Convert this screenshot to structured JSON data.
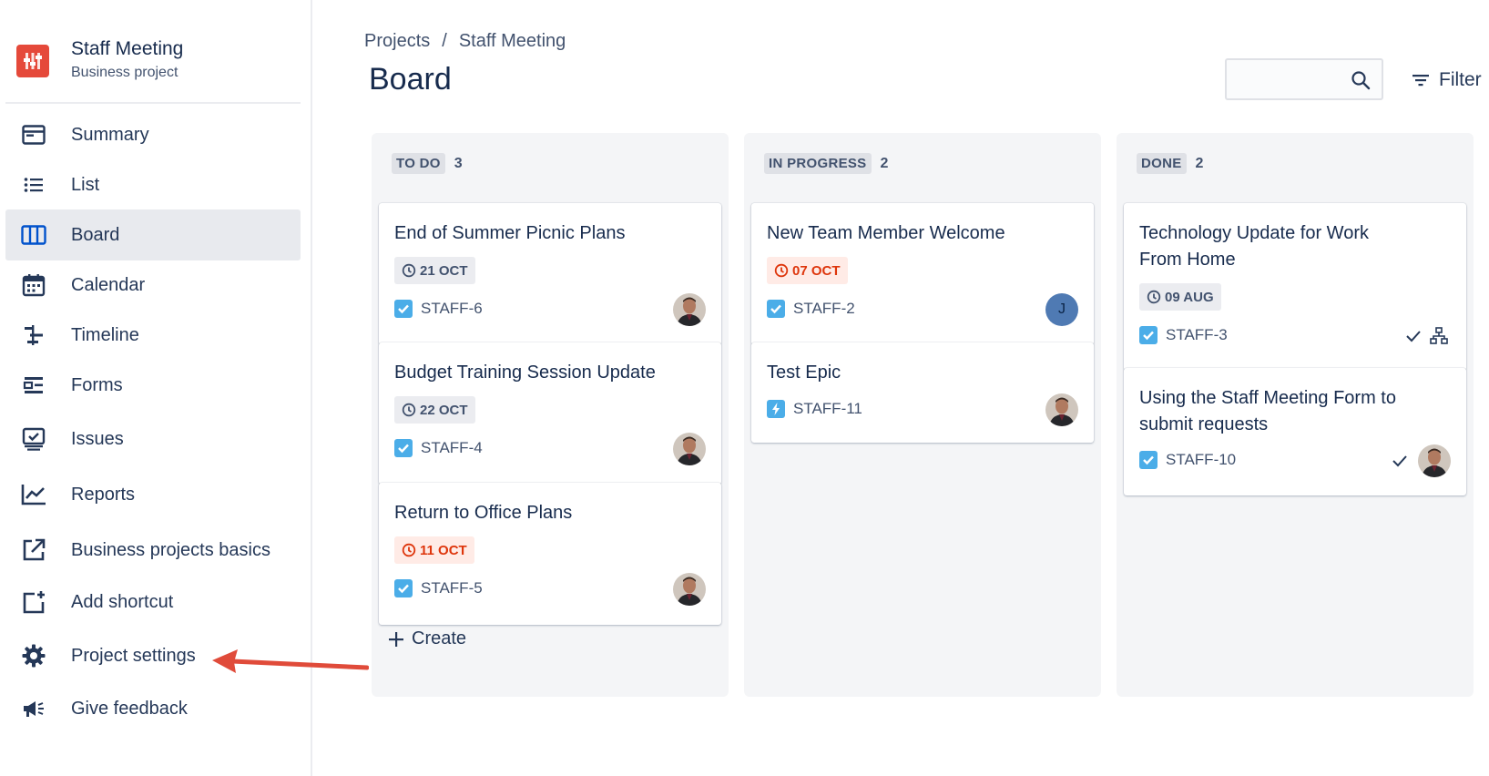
{
  "project": {
    "name": "Staff Meeting",
    "type": "Business project"
  },
  "sidebar": {
    "items": [
      {
        "label": "Summary",
        "icon": "summary-icon"
      },
      {
        "label": "List",
        "icon": "list-icon"
      },
      {
        "label": "Board",
        "icon": "board-icon",
        "active": true
      },
      {
        "label": "Calendar",
        "icon": "calendar-icon"
      },
      {
        "label": "Timeline",
        "icon": "timeline-icon"
      },
      {
        "label": "Forms",
        "icon": "forms-icon"
      },
      {
        "label": "Issues",
        "icon": "issues-icon"
      },
      {
        "label": "Reports",
        "icon": "reports-icon"
      },
      {
        "label": "Business projects basics",
        "icon": "external-link-icon"
      },
      {
        "label": "Add shortcut",
        "icon": "add-shortcut-icon"
      },
      {
        "label": "Project settings",
        "icon": "gear-icon"
      },
      {
        "label": "Give feedback",
        "icon": "megaphone-icon"
      }
    ]
  },
  "breadcrumb": {
    "root": "Projects",
    "separator": "/",
    "current": "Staff Meeting"
  },
  "page": {
    "title": "Board"
  },
  "search": {
    "value": "",
    "placeholder": ""
  },
  "filter": {
    "label": "Filter"
  },
  "columns": [
    {
      "title": "TO DO",
      "count": "3",
      "cards": [
        {
          "title": "End of Summer Picnic Plans",
          "due": "21 OCT",
          "overdue": false,
          "key": "STAFF-6",
          "type": "task"
        },
        {
          "title": "Budget Training Session Update",
          "due": "22 OCT",
          "overdue": false,
          "key": "STAFF-4",
          "type": "task"
        },
        {
          "title": "Return to Office Plans",
          "due": "11 OCT",
          "overdue": true,
          "key": "STAFF-5",
          "type": "task"
        }
      ],
      "create_label": "Create"
    },
    {
      "title": "IN PROGRESS",
      "count": "2",
      "cards": [
        {
          "title": "New Team Member Welcome",
          "due": "07 OCT",
          "overdue": true,
          "key": "STAFF-2",
          "type": "task",
          "avatar_initial": "J"
        },
        {
          "title": "Test Epic",
          "key": "STAFF-11",
          "type": "epic"
        }
      ]
    },
    {
      "title": "DONE",
      "count": "2",
      "cards": [
        {
          "title_line1": "Technology Update for Work",
          "title_line2": "From Home",
          "due": "09 AUG",
          "overdue": false,
          "key": "STAFF-3",
          "type": "task"
        },
        {
          "title_line1": "Using the Staff Meeting Form to",
          "title_line2": "submit requests",
          "key": "STAFF-10",
          "type": "task"
        }
      ]
    }
  ],
  "colors": {
    "accent": "#0052CC",
    "project_logo": "#E5493A",
    "overdue": "#DE350B",
    "task_icon": "#4BADE8",
    "epic_icon": "#6554C0",
    "annotation_arrow": "#E04B3A"
  }
}
